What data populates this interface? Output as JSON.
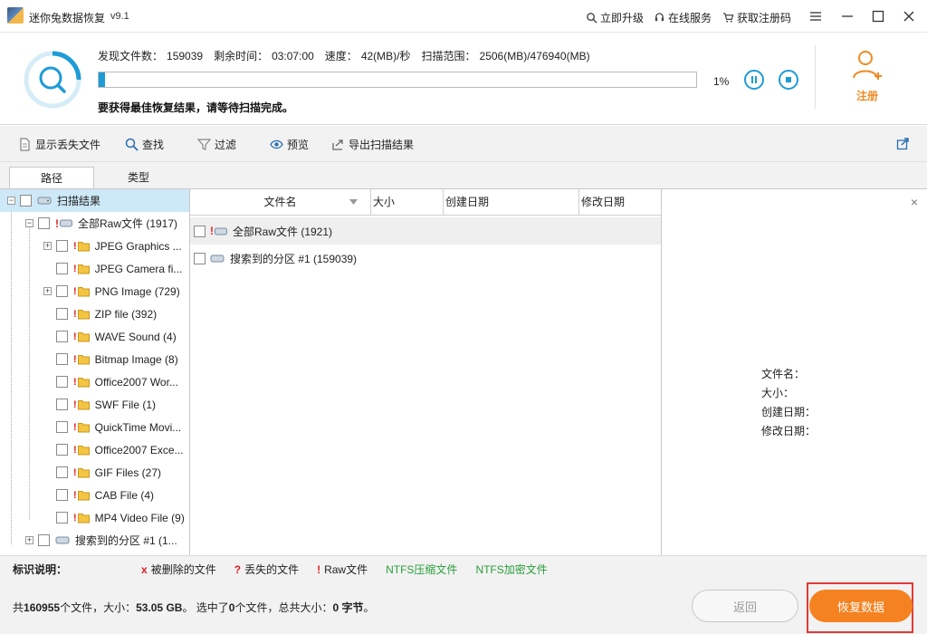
{
  "window": {
    "title": "迷你兔数据恢复",
    "version": "v9.1",
    "links": [
      "立即升级",
      "在线服务",
      "获取注册码"
    ]
  },
  "scan": {
    "found_label": "发现文件数：",
    "found_value": "159039",
    "remaining_label": "剩余时间：",
    "remaining_value": "03:07:00",
    "speed_label": "速度：",
    "speed_value": "42(MB)/秒",
    "range_label": "扫描范围：",
    "range_value": "2506(MB)/476940(MB)",
    "progress_percent": 1,
    "progress_text": "1%",
    "message": "要获得最佳恢复结果，请等待扫描完成。"
  },
  "register": {
    "label": "注册"
  },
  "toolbar": {
    "show_lost": "显示丢失文件",
    "find": "查找",
    "filter": "过滤",
    "preview": "预览",
    "export": "导出扫描结果"
  },
  "tabs": [
    "路径",
    "类型"
  ],
  "tree": {
    "root": "扫描结果",
    "raw_all": "全部Raw文件 (1917)",
    "children": [
      "JPEG Graphics ...",
      "JPEG Camera fi...",
      "PNG Image (729)",
      "ZIP file (392)",
      "WAVE Sound (4)",
      "Bitmap Image (8)",
      "Office2007 Wor...",
      "SWF File (1)",
      "QuickTime Movi...",
      "Office2007 Exce...",
      "GIF Files (27)",
      "CAB File (4)",
      "MP4 Video File (9)"
    ],
    "partition": "搜索到的分区 #1 (1..."
  },
  "columns": [
    "文件名",
    "大小",
    "创建日期",
    "修改日期"
  ],
  "files": [
    "全部Raw文件 (1921)",
    "搜索到的分区 #1 (159039)"
  ],
  "preview_panel": {
    "close": "×",
    "filename": "文件名：",
    "size": "大小：",
    "created": "创建日期：",
    "modified": "修改日期："
  },
  "legend": {
    "title": "标识说明：",
    "deleted": "被删除的文件",
    "lost": "丢失的文件",
    "raw": "Raw文件",
    "ntfs_compressed": "NTFS压缩文件",
    "ntfs_encrypted": "NTFS加密文件",
    "deleted_mark": "x",
    "lost_mark": "?",
    "raw_mark": "!",
    "green": "#2a9d3a",
    "red": "#e02020"
  },
  "status": {
    "prefix": "共",
    "total_files": "160955",
    "files_suffix": "个文件，大小：",
    "total_size": "53.05 GB",
    "sep": "。 选中了",
    "selected_files": "0",
    "selected_suffix": "个文件，总共大小：",
    "selected_size": "0 字节",
    "end": "。"
  },
  "buttons": {
    "back": "返回",
    "recover": "恢复数据"
  },
  "colors": {
    "accent": "#1e9bd7",
    "orange": "#f58220",
    "highlight_frame": "#e53935"
  }
}
